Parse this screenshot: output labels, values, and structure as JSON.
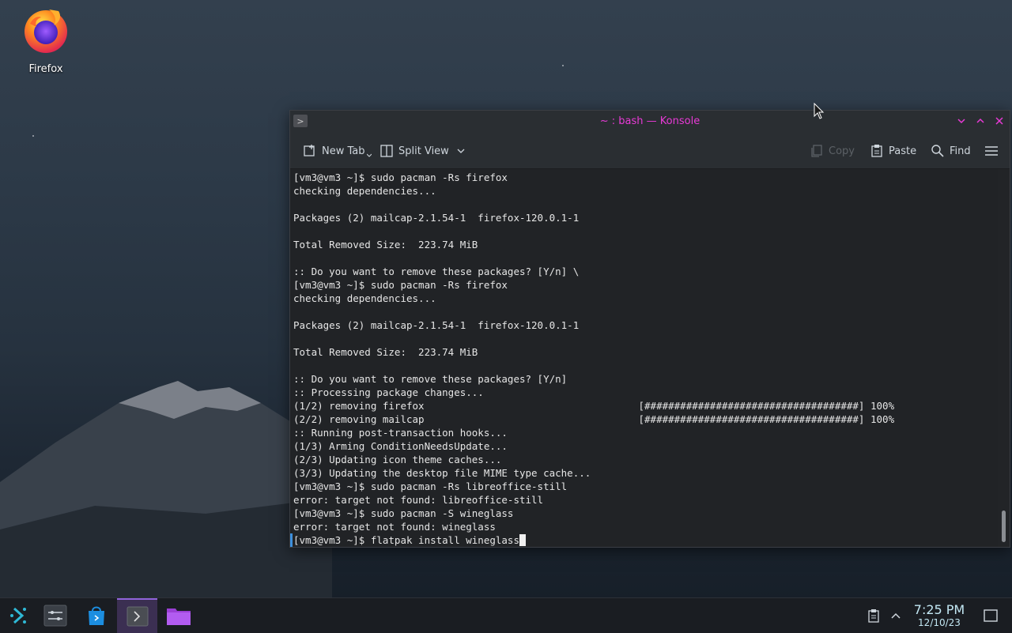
{
  "desktop": {
    "icons": [
      {
        "label": "Firefox",
        "icon": "firefox-icon"
      }
    ]
  },
  "window": {
    "title": "~ : bash — Konsole",
    "title_color": "#e93ad7",
    "toolbar": {
      "new_tab": "New Tab",
      "split_view": "Split View",
      "copy": "Copy",
      "paste": "Paste",
      "find": "Find"
    },
    "terminal_lines": [
      "[vm3@vm3 ~]$ sudo pacman -Rs firefox",
      "checking dependencies...",
      "",
      "Packages (2) mailcap-2.1.54-1  firefox-120.0.1-1",
      "",
      "Total Removed Size:  223.74 MiB",
      "",
      ":: Do you want to remove these packages? [Y/n] \\",
      "[vm3@vm3 ~]$ sudo pacman -Rs firefox",
      "checking dependencies...",
      "",
      "Packages (2) mailcap-2.1.54-1  firefox-120.0.1-1",
      "",
      "Total Removed Size:  223.74 MiB",
      "",
      ":: Do you want to remove these packages? [Y/n]",
      ":: Processing package changes...",
      "(1/2) removing firefox                                    [####################################] 100%",
      "(2/2) removing mailcap                                    [####################################] 100%",
      ":: Running post-transaction hooks...",
      "(1/3) Arming ConditionNeedsUpdate...",
      "(2/3) Updating icon theme caches...",
      "(3/3) Updating the desktop file MIME type cache...",
      "[vm3@vm3 ~]$ sudo pacman -Rs libreoffice-still",
      "error: target not found: libreoffice-still",
      "[vm3@vm3 ~]$ sudo pacman -S wineglass",
      "error: target not found: wineglass",
      "[vm3@vm3 ~]$ flatpak install wineglass"
    ]
  },
  "taskbar": {
    "apps": [
      {
        "name": "application-launcher",
        "icon": "launcher-icon"
      },
      {
        "name": "system-settings",
        "icon": "settings-icon"
      },
      {
        "name": "discover",
        "icon": "store-icon"
      },
      {
        "name": "konsole",
        "icon": "terminal-icon",
        "active": true
      },
      {
        "name": "dolphin",
        "icon": "folder-icon"
      }
    ],
    "clock": {
      "time": "7:25 PM",
      "date": "12/10/23"
    }
  }
}
